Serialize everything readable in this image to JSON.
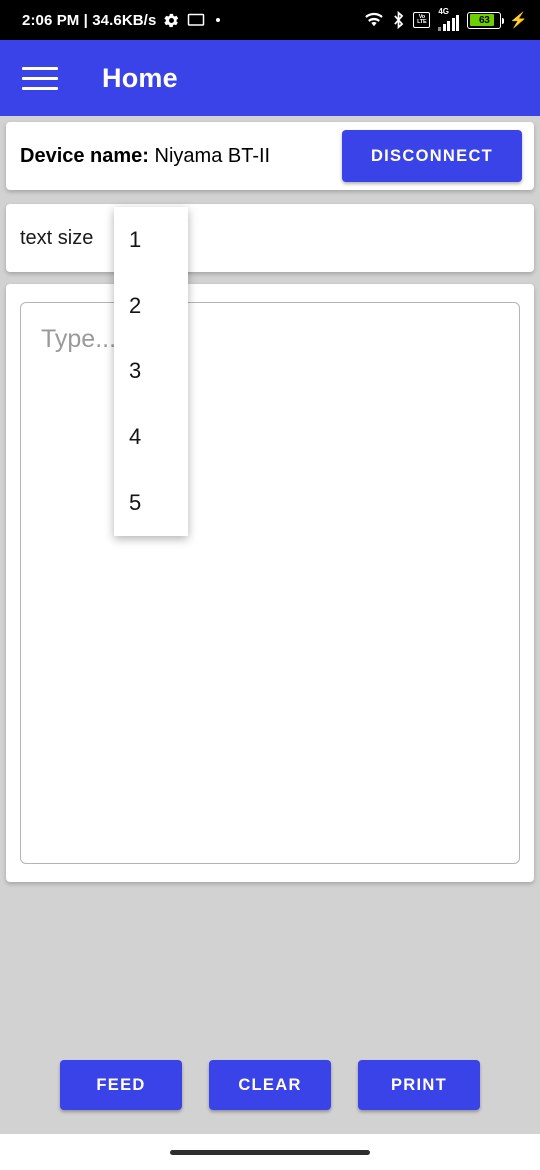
{
  "status_bar": {
    "clock_and_speed": "2:06 PM | 34.6KB/s",
    "gear_icon": "gear-icon",
    "monitor_icon": "monitor-icon",
    "dot_indicator": "dot-indicator",
    "wifi_icon": "wifi-icon",
    "bluetooth_icon": "bluetooth-icon",
    "volte_top": "Vo",
    "volte_bottom": "LTE",
    "network_type": "4G",
    "battery_level": "63",
    "charging_icon": "⚡",
    "battery_color": "#6cd000"
  },
  "app_bar": {
    "menu_icon": "hamburger-menu-icon",
    "title": "Home",
    "background_color": "#3a43e8"
  },
  "device_card": {
    "label": "Device name:",
    "value": " Niyama BT-II",
    "disconnect_label": "DISCONNECT"
  },
  "text_size_row": {
    "label": "text size"
  },
  "dropdown": {
    "options": [
      "1",
      "2",
      "3",
      "4",
      "5"
    ]
  },
  "editor": {
    "placeholder": "Type...",
    "value": ""
  },
  "actions": {
    "feed_label": "FEED",
    "clear_label": "CLEAR",
    "print_label": "PRINT"
  },
  "theme": {
    "accent": "#3a43e8",
    "background": "#d2d2d2"
  }
}
